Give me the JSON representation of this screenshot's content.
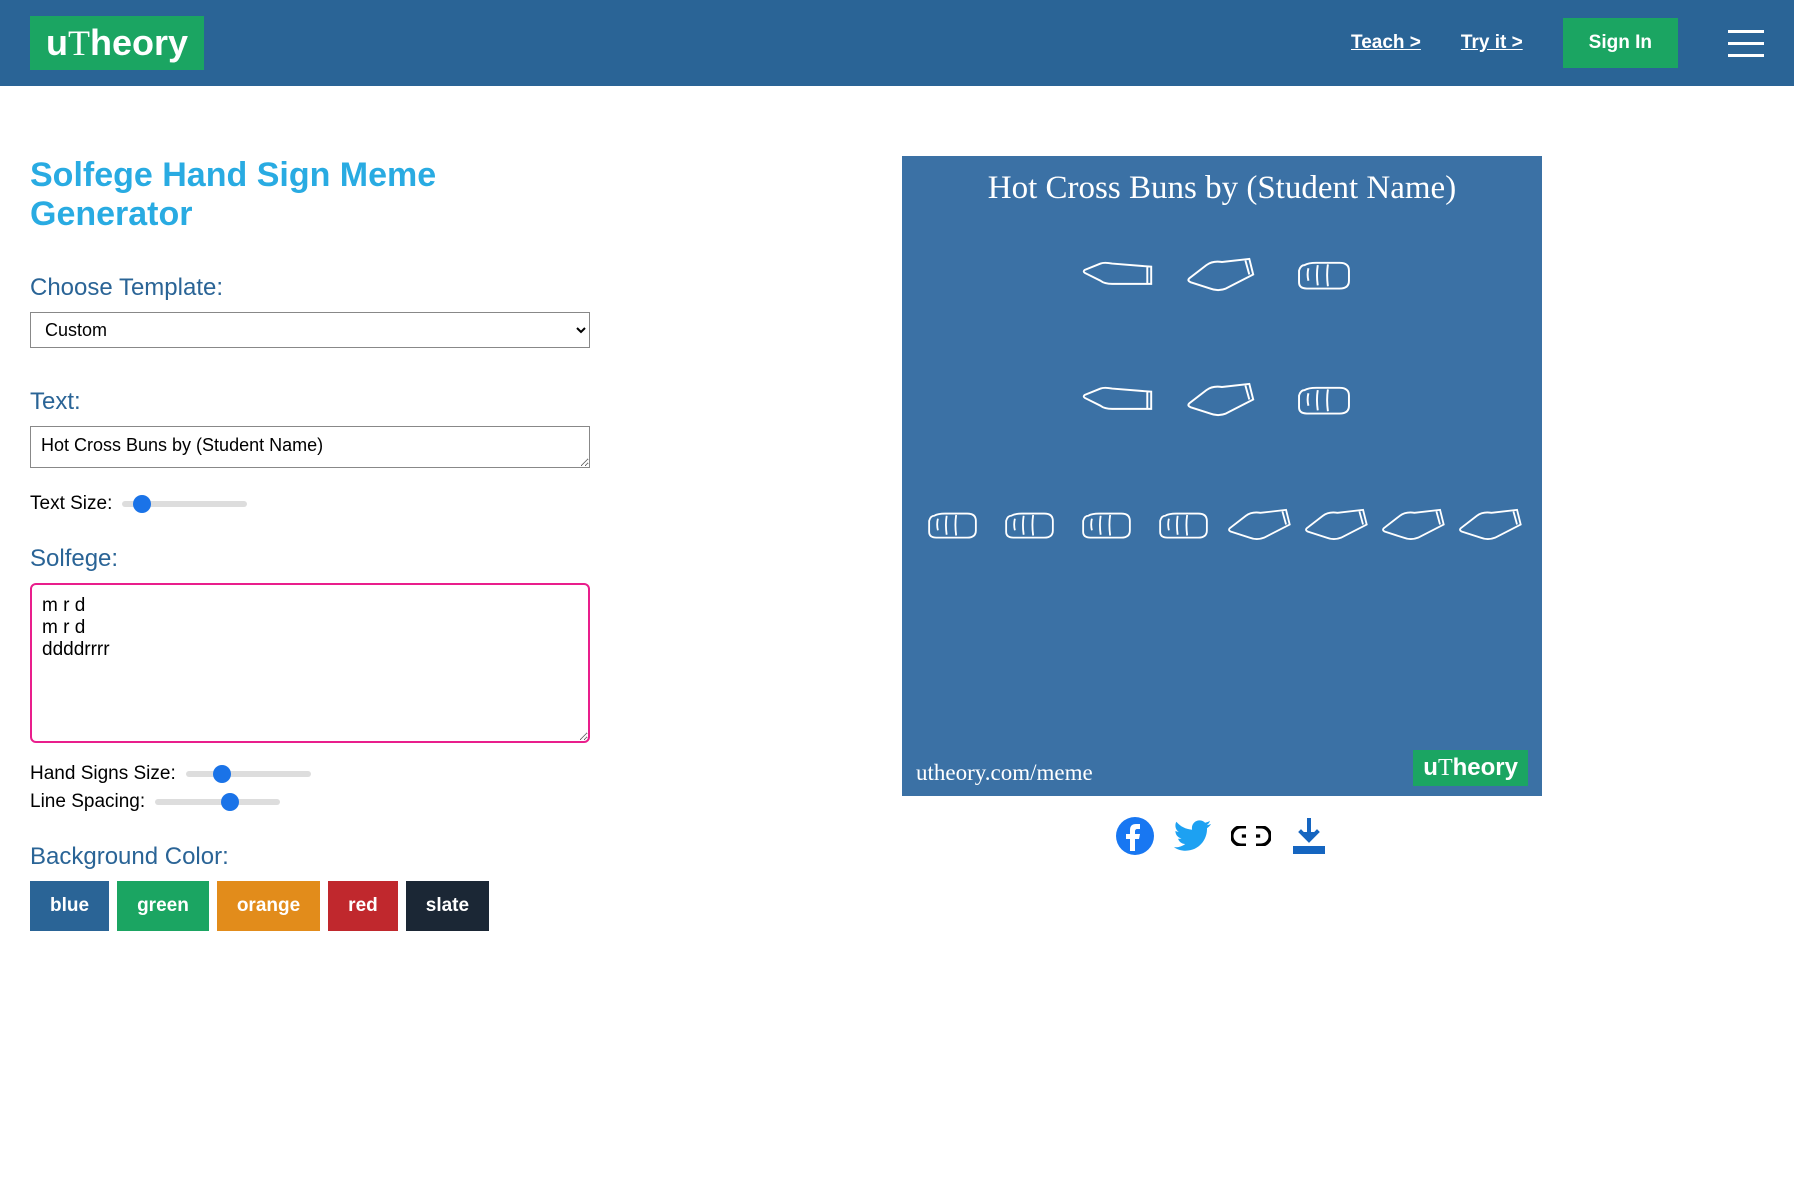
{
  "header": {
    "logo": "uTheory",
    "nav_teach": "Teach >",
    "nav_try": "Try it >",
    "sign_in": "Sign In"
  },
  "page": {
    "title": "Solfege Hand Sign Meme Generator"
  },
  "template": {
    "label": "Choose Template:",
    "value": "Custom"
  },
  "text_section": {
    "label": "Text:",
    "value": "Hot Cross Buns by (Student Name)",
    "size_label": "Text Size:"
  },
  "solfege": {
    "label": "Solfege:",
    "value": "m r d\nm r d\nddddrrrr\n",
    "hand_size_label": "Hand Signs Size:",
    "line_spacing_label": "Line Spacing:"
  },
  "bg": {
    "label": "Background Color:",
    "colors": {
      "blue": "blue",
      "green": "green",
      "orange": "orange",
      "red": "red",
      "slate": "slate"
    }
  },
  "preview": {
    "title": "Hot Cross Buns by (Student Name)",
    "url": "utheory.com/meme",
    "logo": "uTheory"
  }
}
